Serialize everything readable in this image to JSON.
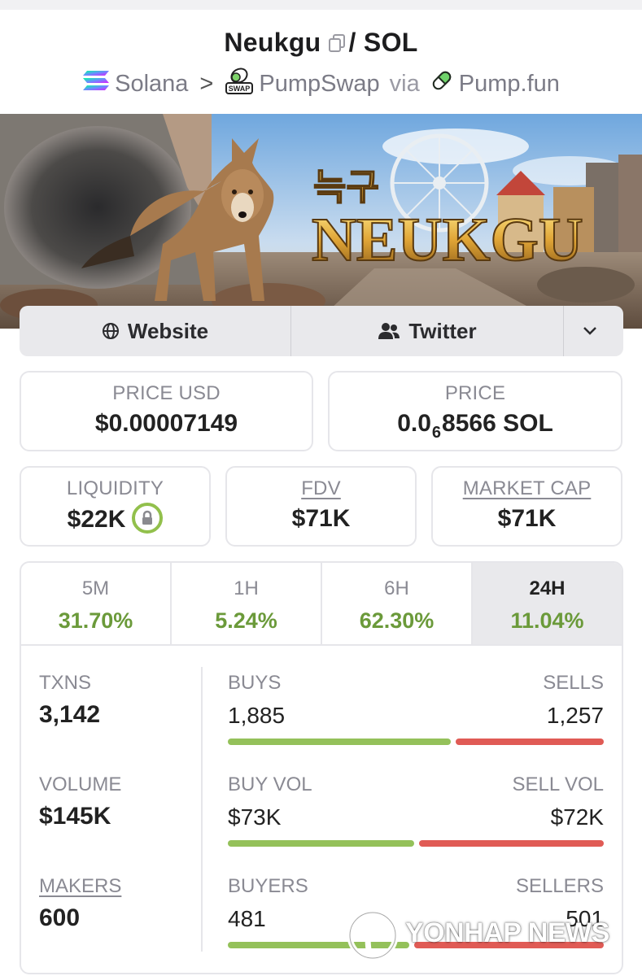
{
  "header": {
    "token_name": "Neukgu",
    "quote": "/ SOL",
    "chain": "Solana",
    "separator": ">",
    "dex": "PumpSwap",
    "dex_badge": "SWAP",
    "via": "via",
    "launchpad": "Pump.fun"
  },
  "banner": {
    "korean_text": "늑구",
    "title_text": "NEUKGU"
  },
  "links": {
    "website": "Website",
    "twitter": "Twitter"
  },
  "price": {
    "usd_label": "PRICE USD",
    "usd_value": "$0.00007149",
    "native_label": "PRICE",
    "native_prefix": "0.0",
    "native_zeros": "6",
    "native_suffix": "8566 SOL"
  },
  "metrics": {
    "liquidity_label": "LIQUIDITY",
    "liquidity_value": "$22K",
    "fdv_label": "FDV",
    "fdv_value": "$71K",
    "mcap_label": "MARKET CAP",
    "mcap_value": "$71K"
  },
  "timeframes": [
    {
      "label": "5M",
      "change": "31.70%"
    },
    {
      "label": "1H",
      "change": "5.24%"
    },
    {
      "label": "6H",
      "change": "62.30%"
    },
    {
      "label": "24H",
      "change": "11.04%",
      "active": true
    }
  ],
  "stats": {
    "txns_label": "TXNS",
    "txns_value": "3,142",
    "volume_label": "VOLUME",
    "volume_value": "$145K",
    "makers_label": "MAKERS",
    "makers_value": "600",
    "buys_label": "BUYS",
    "buys_value": "1,885",
    "sells_label": "SELLS",
    "sells_value": "1,257",
    "buy_share": 0.6,
    "buy_vol_label": "BUY VOL",
    "buy_vol_value": "$73K",
    "sell_vol_label": "SELL VOL",
    "sell_vol_value": "$72K",
    "buy_vol_share": 0.503,
    "buyers_label": "BUYERS",
    "buyers_value": "481",
    "sellers_label": "SELLERS",
    "sellers_value": "501",
    "buyer_share": 0.49
  },
  "colors": {
    "positive": "#6b9a3a",
    "buy_bar": "#94c15a",
    "sell_bar": "#e05b55"
  },
  "watermark": "YONHAP NEWS"
}
